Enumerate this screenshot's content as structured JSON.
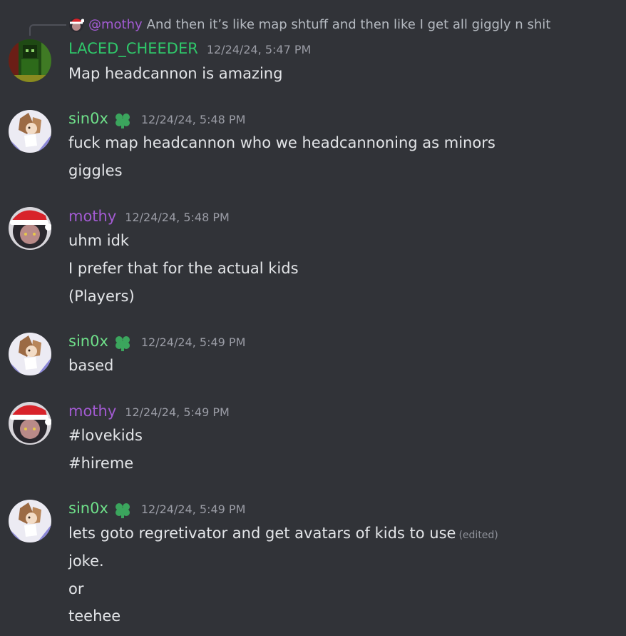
{
  "reply": {
    "mention": "@mothy",
    "text": "And then it’s like map shtuff and then like I get all giggly n shit"
  },
  "messages": [
    {
      "author": "LACED_CHEEDER",
      "timestamp": "12/24/24, 5:47 PM",
      "lines": [
        "Map headcannon is amazing"
      ]
    },
    {
      "author": "sin0x",
      "timestamp": "12/24/24, 5:48 PM",
      "lines": [
        "fuck map headcannon who we headcannoning as minors",
        "giggles"
      ]
    },
    {
      "author": "mothy",
      "timestamp": "12/24/24, 5:48 PM",
      "lines": [
        "uhm idk",
        "I prefer that for the actual kids",
        "(Players)"
      ]
    },
    {
      "author": "sin0x",
      "timestamp": "12/24/24, 5:49 PM",
      "lines": [
        "based"
      ]
    },
    {
      "author": "mothy",
      "timestamp": "12/24/24, 5:49 PM",
      "lines": [
        "#lovekids",
        "#hireme"
      ]
    },
    {
      "author": "sin0x",
      "timestamp": "12/24/24, 5:49 PM",
      "lines": [
        "lets goto regretivator and get avatars of kids to use",
        "joke.",
        "or",
        "teehee"
      ],
      "edited_label": "(edited)"
    }
  ],
  "colors": {
    "background": "#313338",
    "laced_cheeder": "#2fc76a",
    "sin0x": "#6fe08a",
    "mothy": "#a35bd3",
    "text": "#e3e5e8",
    "timestamp": "#9a9ca5"
  }
}
